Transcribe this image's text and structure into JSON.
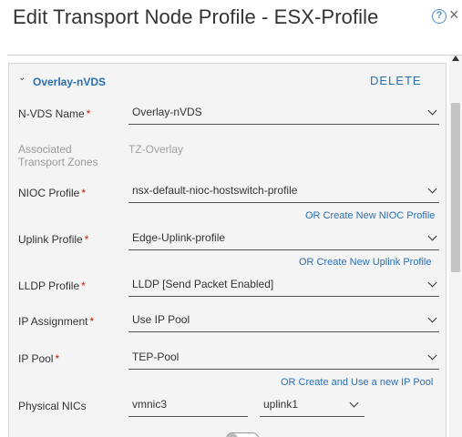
{
  "dialog": {
    "title": "Edit Transport Node Profile - ESX-Profile",
    "help_icon": "?",
    "close_icon": "×"
  },
  "section": {
    "title": "Overlay-nVDS",
    "delete_label": "DELETE"
  },
  "form": {
    "nvds_name": {
      "label": "N-VDS Name",
      "value": "Overlay-nVDS"
    },
    "transport_zones": {
      "label": "Associated Transport Zones",
      "value": "TZ-Overlay"
    },
    "nioc_profile": {
      "label": "NIOC Profile",
      "value": "nsx-default-nioc-hostswitch-profile",
      "create_link": "OR Create New NIOC Profile"
    },
    "uplink_profile": {
      "label": "Uplink Profile",
      "value": "Edge-Uplink-profile",
      "create_link": "OR Create New Uplink Profile"
    },
    "lldp_profile": {
      "label": "LLDP Profile",
      "value": "LLDP [Send Packet Enabled]"
    },
    "ip_assignment": {
      "label": "IP Assignment",
      "value": "Use IP Pool"
    },
    "ip_pool": {
      "label": "IP Pool",
      "value": "TEP-Pool",
      "create_link": "OR Create and Use a new IP Pool"
    },
    "physical_nics": {
      "label": "Physical NICs",
      "nic": "vmnic3",
      "uplink": "uplink1"
    }
  },
  "required_marker": "*",
  "toggle": {
    "state": "off"
  },
  "colors": {
    "link": "#2b6fb3",
    "required": "#c21d00",
    "card_bg": "#f4f4f4"
  },
  "icons": {
    "help": "help-circle-icon",
    "close": "close-icon",
    "section": "chevron-down-icon",
    "dropdown": "chevron-down-icon"
  }
}
